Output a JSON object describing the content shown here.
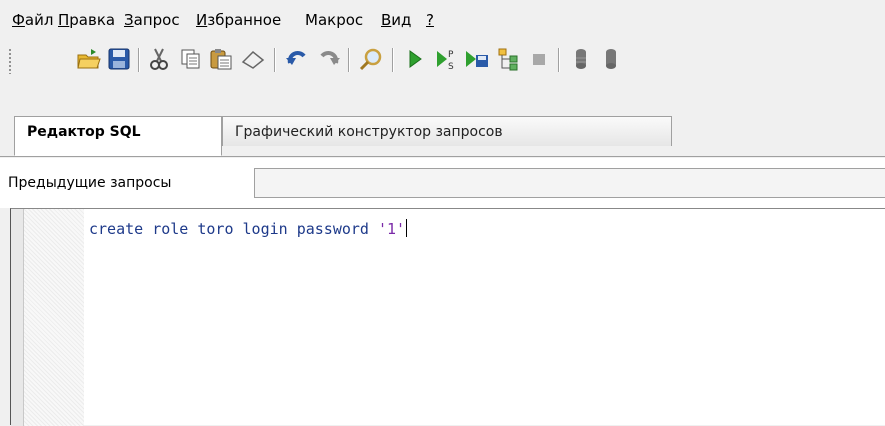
{
  "menu": {
    "items": [
      {
        "key": "Ф",
        "rest": "айл"
      },
      {
        "key": "П",
        "rest": "равка"
      },
      {
        "key": "З",
        "rest": "апрос"
      },
      {
        "key": "И",
        "rest": "збранное"
      },
      {
        "key": "",
        "rest": "Макрос"
      },
      {
        "key": "В",
        "rest": "ид"
      },
      {
        "key": "?",
        "rest": ""
      }
    ]
  },
  "toolbar": {
    "icons": [
      "open-folder-icon",
      "save-icon",
      "cut-icon",
      "copy-icon",
      "paste-icon",
      "eraser-icon",
      "undo-icon",
      "redo-icon",
      "search-icon",
      "run-icon",
      "run-script-icon",
      "run-to-file-icon",
      "explain-plan-icon",
      "stop-icon",
      "commit-icon",
      "rollback-icon"
    ]
  },
  "tabs": {
    "sql_editor": "Редактор SQL",
    "query_builder": "Графический конструктор запросов"
  },
  "previous_queries": {
    "label": "Предыдущие запросы",
    "value": ""
  },
  "editor": {
    "code_prefix": "create role toro login password ",
    "code_string": "'1'"
  },
  "colors": {
    "keyword": "#1e3a8a",
    "string": "#7a2aa8",
    "run_green": "#2fa02f"
  }
}
